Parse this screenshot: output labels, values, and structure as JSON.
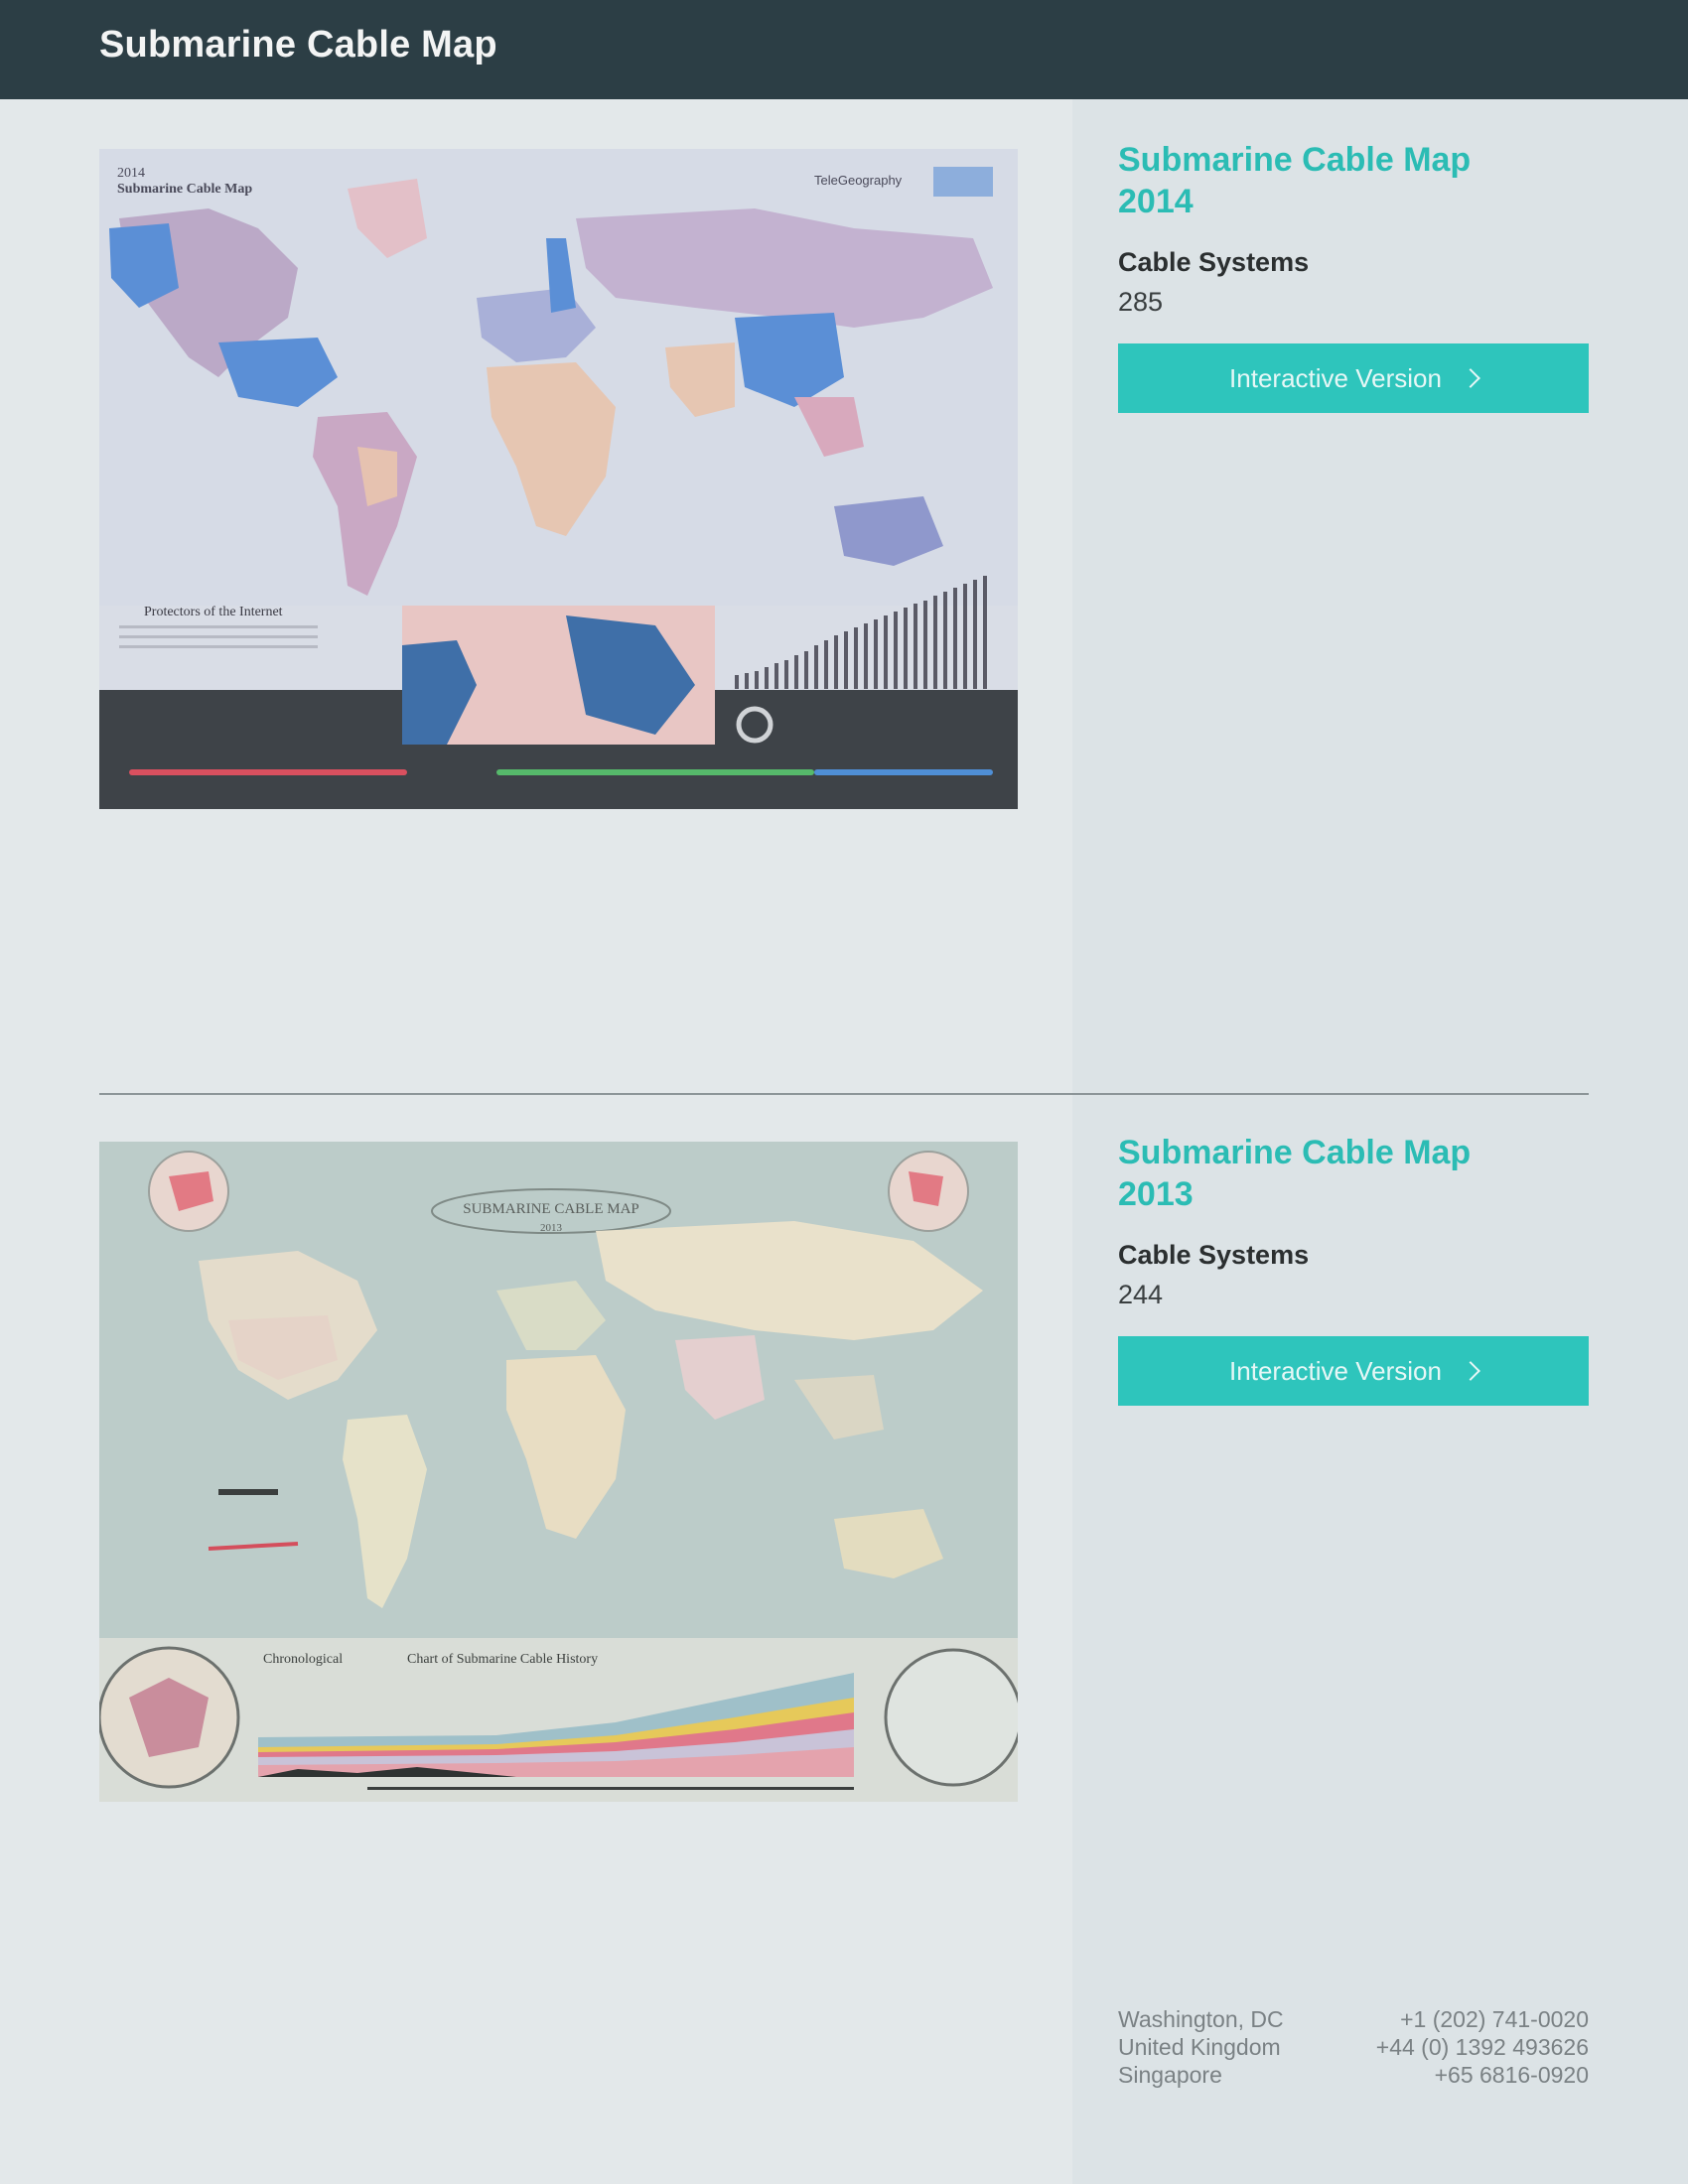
{
  "header": {
    "title": "Submarine Cable Map"
  },
  "maps": [
    {
      "title_line1": "Submarine Cable Map",
      "title_line2": "2014",
      "stat_label": "Cable Systems",
      "stat_value": "285",
      "button_label": "Interactive Version",
      "image_alt": "2014 Submarine Cable Map poster",
      "poster_year": "2014",
      "poster_title": "Submarine Cable Map",
      "poster_brand": "TeleGeography",
      "poster_section": "Protectors of the Internet"
    },
    {
      "title_line1": "Submarine Cable Map",
      "title_line2": "2013",
      "stat_label": "Cable Systems",
      "stat_value": "244",
      "button_label": "Interactive Version",
      "image_alt": "2013 Submarine Cable Map poster",
      "poster_title": "SUBMARINE CABLE MAP",
      "poster_year": "2013",
      "poster_chart_title_a": "Chronological",
      "poster_chart_title_b": "Chart of Submarine Cable History"
    }
  ],
  "footer": {
    "offices": [
      {
        "city": "Washington, DC",
        "phone": "+1 (202) 741-0020"
      },
      {
        "city": "United Kingdom",
        "phone": "+44 (0) 1392 493626"
      },
      {
        "city": "Singapore",
        "phone": "+65 6816-0920"
      }
    ]
  },
  "colors": {
    "header_bg": "#2c3e45",
    "accent": "#2bbcb4",
    "button_bg": "#2ec5bc",
    "page_bg": "#e3e8ea"
  }
}
